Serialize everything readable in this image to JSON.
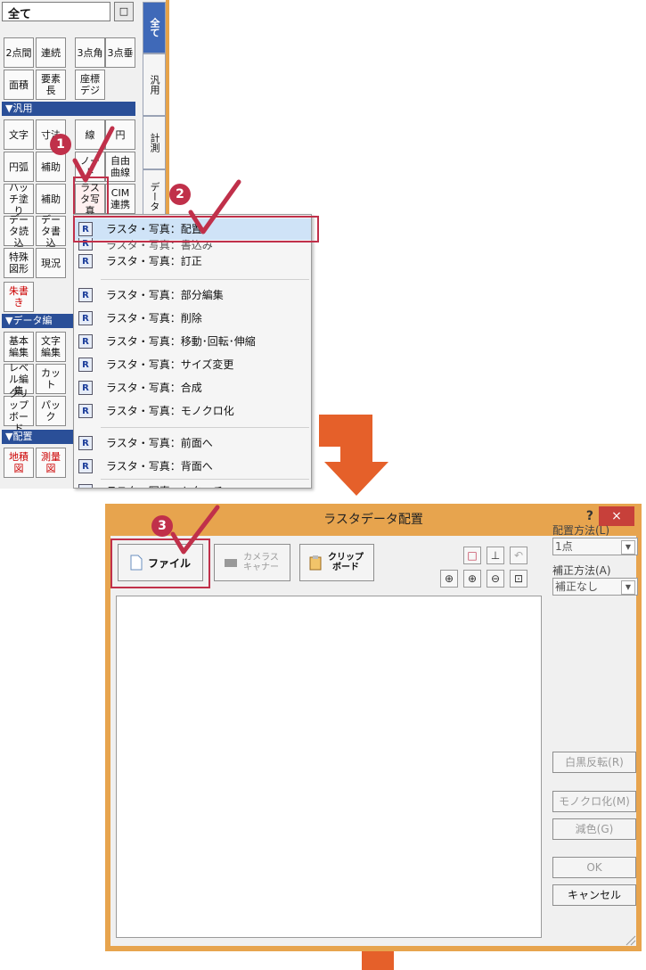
{
  "palette": {
    "combo_value": "全て",
    "combo_button": "□",
    "vtabs": [
      "全て",
      "汎用",
      "計測",
      "データ"
    ],
    "rows": [
      [
        "2点間",
        "連続",
        "3点角",
        "3点垂"
      ],
      [
        "面積",
        "要素長",
        "座標デジ"
      ],
      [
        "文字",
        "寸法",
        "線",
        "円"
      ],
      [
        "円弧",
        "補助",
        "ノード",
        "自由曲線"
      ],
      [
        "ハッチ塗り",
        "補助",
        "ラスタ写真",
        "CIM連携"
      ],
      [
        "データ読込",
        "データ書込"
      ],
      [
        "特殊図形",
        "現況"
      ],
      [
        "朱書き"
      ],
      [
        "基本編集",
        "文字編集"
      ],
      [
        "レベル編集",
        "カット"
      ],
      [
        "クリップボード",
        "パック"
      ],
      [
        "地積図",
        "測量図"
      ]
    ],
    "sections": [
      "▼汎用",
      "▼データ編",
      "▼配置"
    ]
  },
  "menu": {
    "items": [
      "ラスタ・写真：配置",
      "ラスタ・写真：書込み",
      "ラスタ・写真：訂正",
      "ラスタ・写真：部分編集",
      "ラスタ・写真：削除",
      "ラスタ・写真：移動･回転･伸縮",
      "ラスタ・写真：サイズ変更",
      "ラスタ・写真：合成",
      "ラスタ・写真：モノクロ化",
      "ラスタ・写真：前面へ",
      "ラスタ・写真：背面へ",
      "ラスタ・写真：トタッチ"
    ],
    "icon": "R"
  },
  "steps": [
    "1",
    "2",
    "3"
  ],
  "dialog": {
    "title": "ラスタデータ配置",
    "help": "?",
    "close": "×",
    "file_button": "ファイル",
    "camera_button": "カメラスキャナー",
    "clipboard_button": "クリップボード",
    "placement_label": "配置方法(L)",
    "placement_value": "1点",
    "correction_label": "補正方法(A)",
    "correction_value": "補正なし",
    "invert_button": "白黒反転(R)",
    "mono_button": "モノクロ化(M)",
    "reduce_button": "減色(G)",
    "ok_button": "OK",
    "cancel_button": "キャンセル"
  },
  "colors": {
    "accent": "#e7a44e",
    "highlight": "#c0304a",
    "arrow": "#e5602a",
    "selected": "#cfe3f7"
  }
}
